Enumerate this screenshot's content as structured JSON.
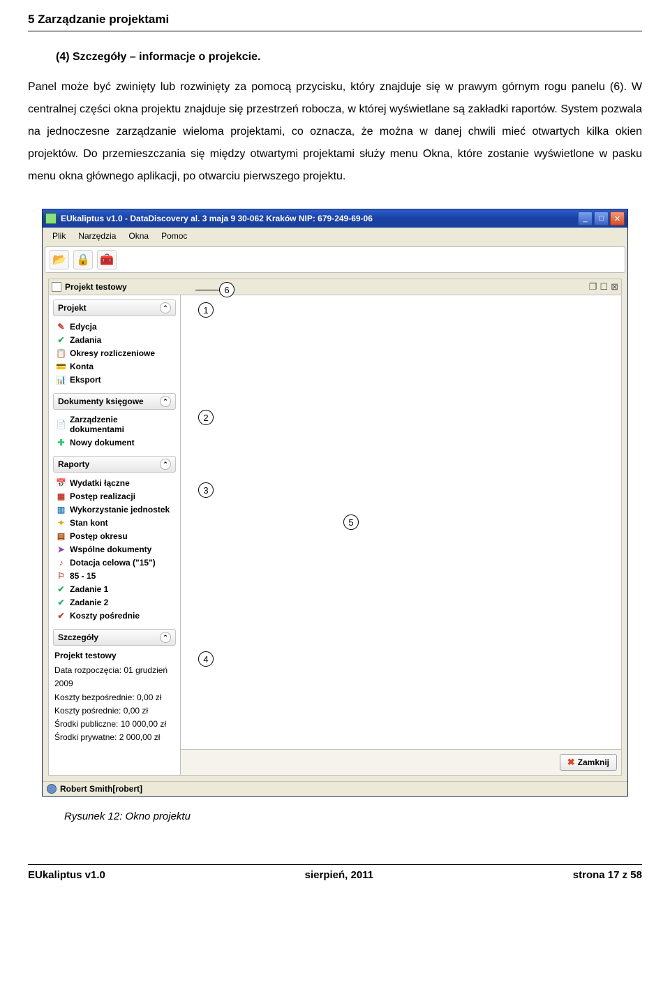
{
  "page": {
    "header": "5 Zarządzanie projektami",
    "subhead": "(4)  Szczegóły – informacje o projekcie.",
    "body": "Panel może być zwinięty lub rozwinięty za pomocą przycisku, który znajduje się w prawym górnym rogu panelu (6). W centralnej części okna projektu znajduje się przestrzeń robocza, w której wyświetlane są zakładki raportów. System pozwala na jednoczesne zarządzanie wieloma projektami, co oznacza, że można w danej chwili mieć otwartych kilka okien projektów. Do przemieszczania się między otwartymi projektami służy menu Okna, które zostanie wyświetlone w pasku menu okna głównego aplikacji, po otwarciu pierwszego projektu.",
    "caption": "Rysunek 12: Okno projektu"
  },
  "app": {
    "title": "EUkaliptus v1.0 - DataDiscovery al. 3 maja 9 30-062 Kraków NIP: 679-249-69-06",
    "menu": {
      "plik": "Plik",
      "narzedzia": "Narzędzia",
      "okna": "Okna",
      "pomoc": "Pomoc"
    },
    "inner_title": "Projekt testowy",
    "sections": {
      "projekt": {
        "title": "Projekt",
        "items": [
          {
            "icon": "✎",
            "label": "Edycja",
            "color": "#c0392b"
          },
          {
            "icon": "✔",
            "label": "Zadania",
            "color": "#27ae60"
          },
          {
            "icon": "📋",
            "label": "Okresy rozliczeniowe",
            "color": "#888"
          },
          {
            "icon": "💳",
            "label": "Konta",
            "color": "#2980b9"
          },
          {
            "icon": "📊",
            "label": "Eksport",
            "color": "#27ae60"
          }
        ]
      },
      "dokumenty": {
        "title": "Dokumenty księgowe",
        "items": [
          {
            "icon": "📄",
            "label": "Zarządzenie dokumentami",
            "color": "#5dade2"
          },
          {
            "icon": "✚",
            "label": "Nowy dokument",
            "color": "#2ecc71"
          }
        ]
      },
      "raporty": {
        "title": "Raporty",
        "items": [
          {
            "icon": "📅",
            "label": "Wydatki łączne",
            "color": "#c0a050"
          },
          {
            "icon": "▦",
            "label": "Postęp realizacji",
            "color": "#c0392b"
          },
          {
            "icon": "▥",
            "label": "Wykorzystanie jednostek",
            "color": "#2980b9"
          },
          {
            "icon": "✦",
            "label": "Stan kont",
            "color": "#d4ac0d"
          },
          {
            "icon": "▤",
            "label": "Postęp okresu",
            "color": "#a04000"
          },
          {
            "icon": "➤",
            "label": "Wspólne dokumenty",
            "color": "#8e44ad"
          },
          {
            "icon": "♪",
            "label": "Dotacja celowa (\"15\")",
            "color": "#c0392b"
          },
          {
            "icon": "⚐",
            "label": "85 - 15",
            "color": "#c0392b"
          },
          {
            "icon": "✔",
            "label": "Zadanie 1",
            "color": "#27ae60"
          },
          {
            "icon": "✔",
            "label": "Zadanie 2",
            "color": "#27ae60"
          },
          {
            "icon": "✔",
            "label": "Koszty pośrednie",
            "color": "#c0392b"
          }
        ]
      },
      "szczegoly": {
        "title": "Szczegóły",
        "project_name": "Projekt testowy",
        "lines": [
          "Data rozpoczęcia: 01 grudzień 2009",
          "Koszty bezpośrednie: 0,00 zł",
          "Koszty pośrednie: 0,00 zł",
          "Środki publiczne: 10 000,00 zł",
          "Środki prywatne: 2 000,00 zł"
        ]
      }
    },
    "close_btn": "Zamknij",
    "status_user": "Robert Smith[robert]"
  },
  "callouts": {
    "c1": "1",
    "c2": "2",
    "c3": "3",
    "c4": "4",
    "c5": "5",
    "c6": "6"
  },
  "footer": {
    "left": "EUkaliptus v1.0",
    "center": "sierpień, 2011",
    "right": "strona 17 z 58"
  }
}
